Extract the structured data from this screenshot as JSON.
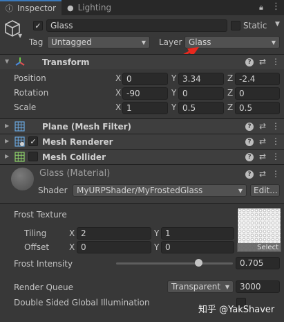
{
  "tabs": {
    "inspector": "Inspector",
    "lighting": "Lighting"
  },
  "gameobject": {
    "name": "Glass",
    "active": true,
    "static_label": "Static",
    "tag_label": "Tag",
    "tag_value": "Untagged",
    "layer_label": "Layer",
    "layer_value": "Glass"
  },
  "transform": {
    "title": "Transform",
    "position_label": "Position",
    "rotation_label": "Rotation",
    "scale_label": "Scale",
    "position": {
      "x": "0",
      "y": "3.34",
      "z": "-2.4"
    },
    "rotation": {
      "x": "-90",
      "y": "0",
      "z": "0"
    },
    "scale": {
      "x": "1",
      "y": "0.5",
      "z": "0.5"
    }
  },
  "components": {
    "mesh_filter": "Plane (Mesh Filter)",
    "mesh_renderer": "Mesh Renderer",
    "mesh_collider": "Mesh Collider"
  },
  "axes": {
    "x": "X",
    "y": "Y",
    "z": "Z"
  },
  "material": {
    "title": "Glass (Material)",
    "shader_label": "Shader",
    "shader_value": "MyURPShader/MyFrostedGlass",
    "edit_label": "Edit...",
    "frost_texture_label": "Frost Texture",
    "tiling_label": "Tiling",
    "offset_label": "Offset",
    "tiling": {
      "x": "2",
      "y": "1"
    },
    "offset": {
      "x": "0",
      "y": "0"
    },
    "select_label": "Select",
    "frost_intensity_label": "Frost Intensity",
    "frost_intensity_value": "0.705",
    "frost_intensity_fraction": 0.705,
    "render_queue_label": "Render Queue",
    "render_queue_mode": "Transparent",
    "render_queue_value": "3000",
    "double_sided_gi_label": "Double Sided Global Illumination",
    "double_sided_gi": false
  },
  "watermark": "知乎 @YakShaver",
  "colors": {
    "background": "#383838",
    "header": "#3e3e3e",
    "accent_tab": "#3a79bb",
    "annotation_arrow": "#e8281e"
  }
}
